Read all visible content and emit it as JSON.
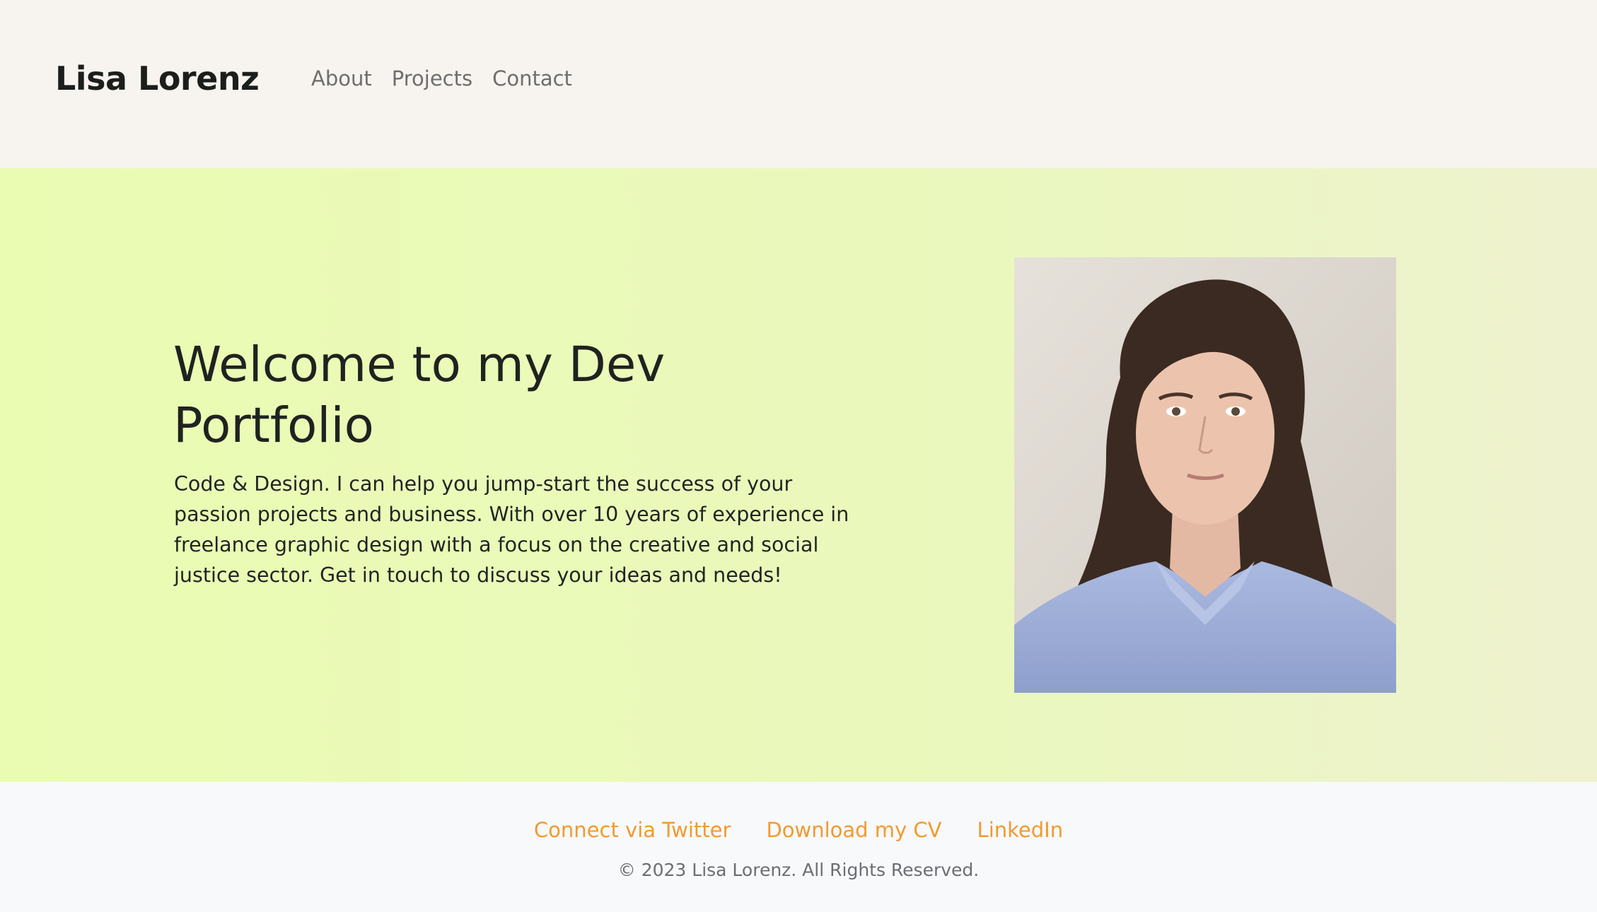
{
  "header": {
    "brand": "Lisa Lorenz",
    "nav": [
      "About",
      "Projects",
      "Contact"
    ]
  },
  "hero": {
    "title": "Welcome to my Dev Portfolio",
    "description": "Code & Design. I can help you jump-start the success of your passion projects and business. With over 10 years of experience in freelance graphic design with a focus on the creative and social justice sector. Get in touch to discuss your ideas and needs!",
    "portrait_icon": "person-photo"
  },
  "footer": {
    "links": [
      "Connect via Twitter",
      "Download my CV",
      "LinkedIn"
    ],
    "copyright": "© 2023 Lisa Lorenz. All Rights Reserved."
  },
  "colors": {
    "header_bg": "#f7f3ee",
    "hero_bg": "#eafcb2",
    "footer_bg": "#f8f9fb",
    "link_accent": "#f29a2e",
    "text_dark": "#1e2320"
  }
}
